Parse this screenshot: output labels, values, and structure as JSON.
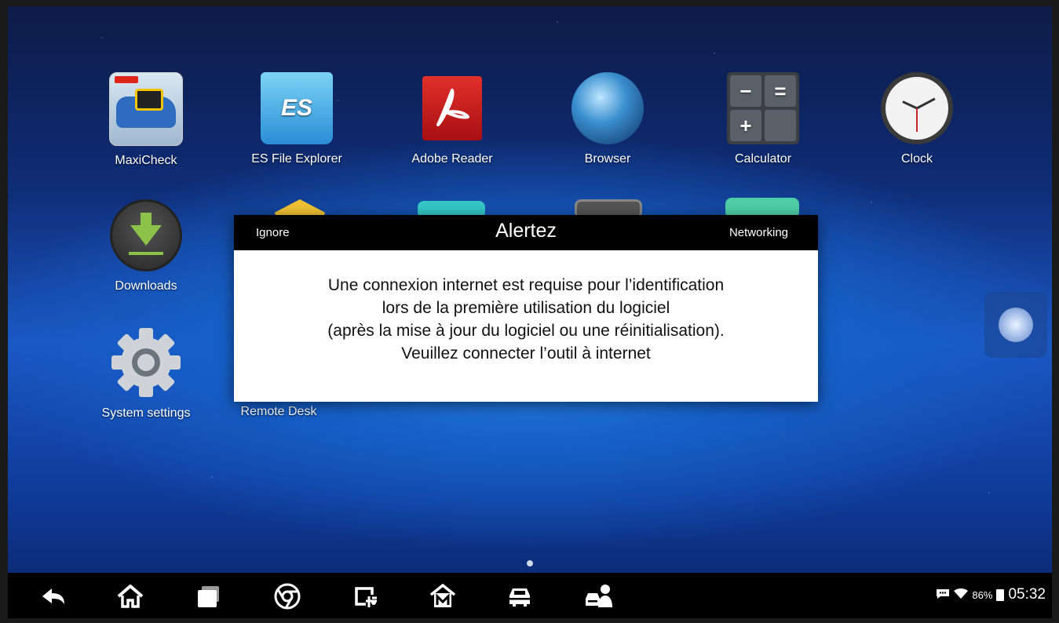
{
  "apps": [
    {
      "label": "MaxiCheck"
    },
    {
      "label": "ES File Explorer",
      "badge": "ES"
    },
    {
      "label": "Adobe Reader"
    },
    {
      "label": "Browser"
    },
    {
      "label": "Calculator",
      "keys": [
        "−",
        "=",
        "+",
        ""
      ]
    },
    {
      "label": "Clock"
    },
    {
      "label": "Downloads"
    },
    {
      "label": "System settings"
    },
    {
      "label": "Remote Desk"
    }
  ],
  "dialog": {
    "ignore_label": "Ignore",
    "title": "Alertez",
    "networking_label": "Networking",
    "message_lines": [
      "Une connexion internet est requise pour l’identification",
      "lors de la première utilisation du logiciel",
      "(après la mise à jour du logiciel ou une réinitialisation).",
      "Veuillez connecter l’outil à internet"
    ]
  },
  "navbar": {
    "icons": [
      "back-icon",
      "home-icon",
      "recent-apps-icon",
      "chrome-icon",
      "screen-capture-icon",
      "maxi-home-icon",
      "vehicle-icon",
      "remote-support-icon"
    ]
  },
  "status": {
    "battery": "86%",
    "time": "05:32",
    "icons": [
      "message-icon",
      "wifi-icon",
      "battery-icon"
    ]
  },
  "colors": {
    "accent_green": "#8bc34a",
    "dialog_bar": "#000000",
    "pdf_red": "#e2302b"
  }
}
